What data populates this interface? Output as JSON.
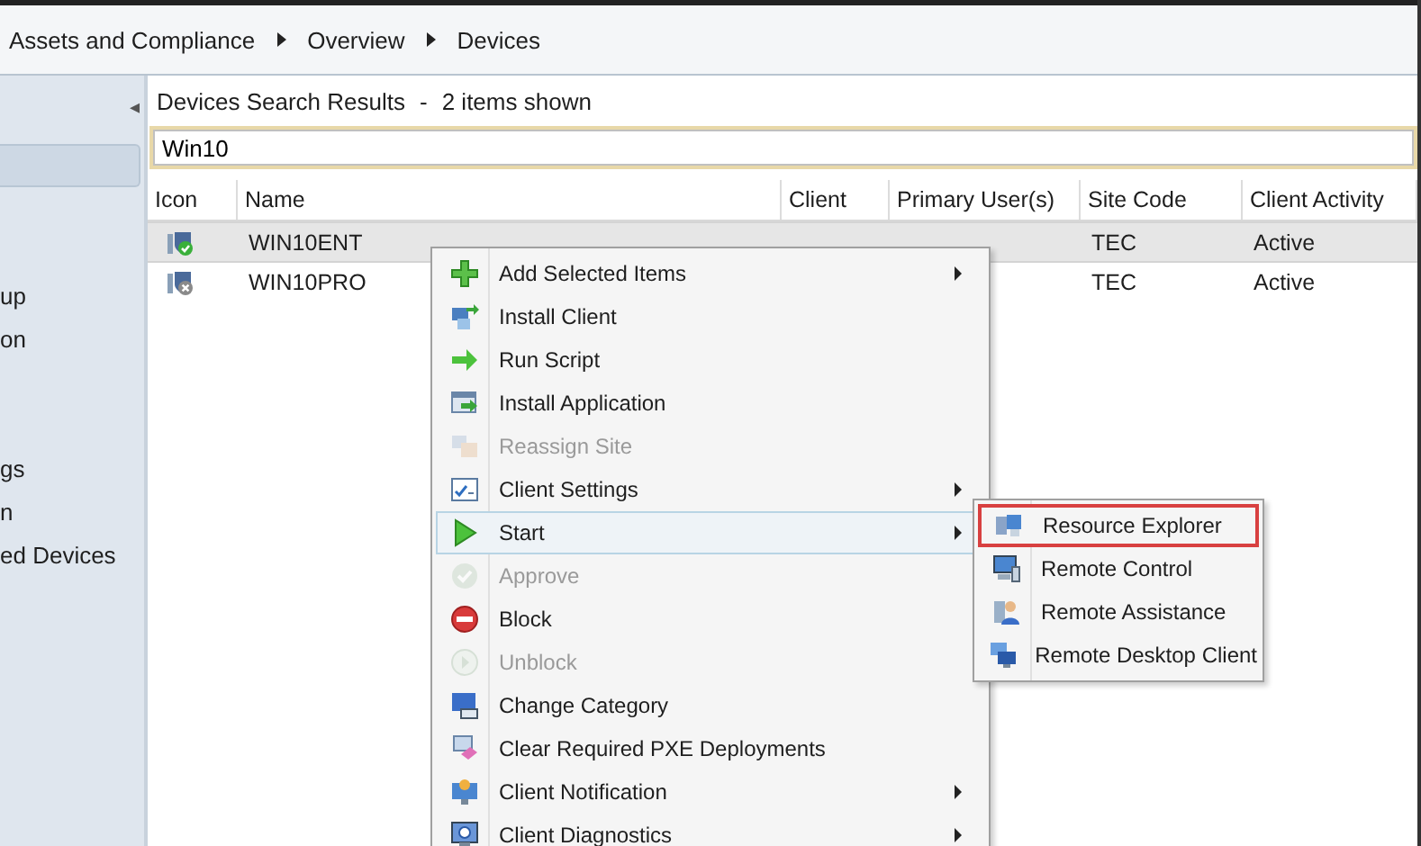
{
  "breadcrumb": [
    "Assets and Compliance",
    "Overview",
    "Devices"
  ],
  "sidebar": {
    "collapse": "◂",
    "groups": [
      [
        {
          "selected": true
        }
      ],
      [
        {
          "label": "up",
          "selected": false
        },
        {
          "label": "on",
          "selected": false
        }
      ],
      [
        {
          "label": "gs",
          "selected": false
        },
        {
          "label": "n",
          "selected": false
        },
        {
          "label": "ed Devices",
          "selected": false
        }
      ]
    ]
  },
  "results": {
    "title": "Devices Search Results",
    "separator": "-",
    "count": "2 items shown",
    "search": {
      "value": "Win10"
    }
  },
  "table": {
    "columns": [
      "Icon",
      "Name",
      "Client",
      "Primary User(s)",
      "Site Code",
      "Client Activity"
    ],
    "rows": [
      {
        "kind": "ok",
        "name": "WIN10ENT",
        "site": "TEC",
        "activity": "Active",
        "selected": true
      },
      {
        "kind": "blocked",
        "name": "WIN10PRO",
        "site": "TEC",
        "activity": "Active",
        "selected": false
      }
    ]
  },
  "context_menu": {
    "items": [
      {
        "kind": "add",
        "label": "Add Selected Items",
        "disabled": false,
        "submenu": true,
        "selected": false
      },
      {
        "kind": "install",
        "label": "Install Client",
        "disabled": false,
        "submenu": false,
        "selected": false
      },
      {
        "kind": "arrow",
        "label": "Run Script",
        "disabled": false,
        "submenu": false,
        "selected": false
      },
      {
        "kind": "app",
        "label": "Install Application",
        "disabled": false,
        "submenu": false,
        "selected": false
      },
      {
        "kind": "reassign",
        "label": "Reassign Site",
        "disabled": true,
        "submenu": false,
        "selected": false
      },
      {
        "kind": "settings",
        "label": "Client Settings",
        "disabled": false,
        "submenu": true,
        "selected": false
      },
      {
        "kind": "play",
        "label": "Start",
        "disabled": false,
        "submenu": true,
        "selected": true
      },
      {
        "kind": "approve",
        "label": "Approve",
        "disabled": true,
        "submenu": false,
        "selected": false
      },
      {
        "kind": "block",
        "label": "Block",
        "disabled": false,
        "submenu": false,
        "selected": false
      },
      {
        "kind": "unblock",
        "label": "Unblock",
        "disabled": true,
        "submenu": false,
        "selected": false
      },
      {
        "kind": "category",
        "label": "Change Category",
        "disabled": false,
        "submenu": false,
        "selected": false
      },
      {
        "kind": "pxe",
        "label": "Clear Required PXE Deployments",
        "disabled": false,
        "submenu": false,
        "selected": false
      },
      {
        "kind": "notify",
        "label": "Client Notification",
        "disabled": false,
        "submenu": true,
        "selected": false
      },
      {
        "kind": "diag",
        "label": "Client Diagnostics",
        "disabled": false,
        "submenu": true,
        "selected": false
      }
    ]
  },
  "submenu": {
    "items": [
      {
        "kind": "explorer",
        "label": "Resource Explorer",
        "selected": true
      },
      {
        "kind": "remote",
        "label": "Remote Control",
        "selected": false
      },
      {
        "kind": "assist",
        "label": "Remote Assistance",
        "selected": false
      },
      {
        "kind": "rdp",
        "label": "Remote Desktop Client",
        "selected": false
      }
    ]
  }
}
